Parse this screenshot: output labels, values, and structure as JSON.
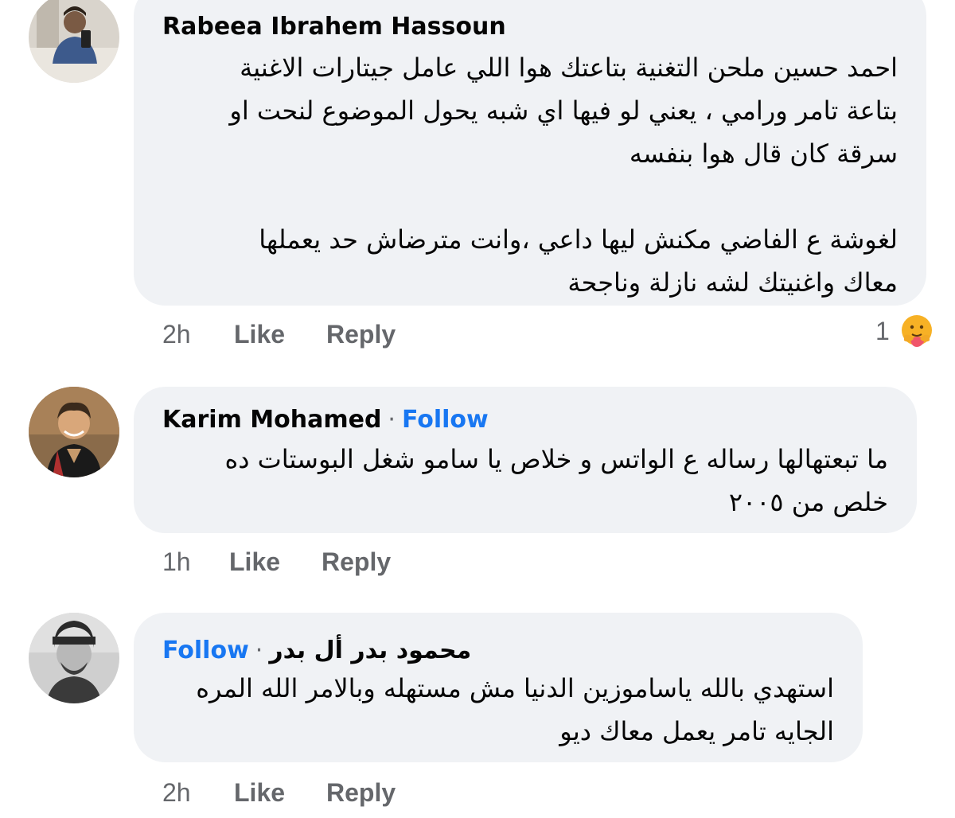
{
  "comments": [
    {
      "author": "Rabeea Ibrahem Hassoun",
      "follow_label": "",
      "body_lines": [
        "احمد حسين ملحن التغنية بتاعتك هوا اللي عامل جيتارات الاغنية",
        "بتاعة تامر ورامي ، يعني لو فيها اي شبه يحول الموضوع لنحت او",
        "سرقة كان قال هوا بنفسه",
        "",
        "لغوشة ع الفاضي مكنش ليها داعي ،وانت مترضاش حد يعملها",
        "معاك واغنيتك لشه نازلة وناجحة"
      ],
      "time": "2h",
      "like_label": "Like",
      "reply_label": "Reply",
      "reaction_count": "1",
      "reaction_icon": "care-reaction-icon"
    },
    {
      "author": "Karim Mohamed",
      "separator": "·",
      "follow_label": "Follow",
      "body_lines": [
        "ما تبعتهالها رساله ع الواتس و خلاص يا سامو شغل البوستات ده",
        "خلص من ٢٠٠٥"
      ],
      "time": "1h",
      "like_label": "Like",
      "reply_label": "Reply"
    },
    {
      "author": "محمود بدر أل بدر",
      "separator": "·",
      "follow_label": "Follow",
      "body_lines": [
        "استهدي بالله ياساموزين الدنيا مش مستهله وبالامر الله المره",
        "الجايه تامر يعمل معاك ديو"
      ],
      "time": "2h",
      "like_label": "Like",
      "reply_label": "Reply"
    }
  ],
  "colors": {
    "bubble": "#f0f2f5",
    "follow": "#1877f2",
    "meta": "#65676b",
    "text": "#050505"
  }
}
